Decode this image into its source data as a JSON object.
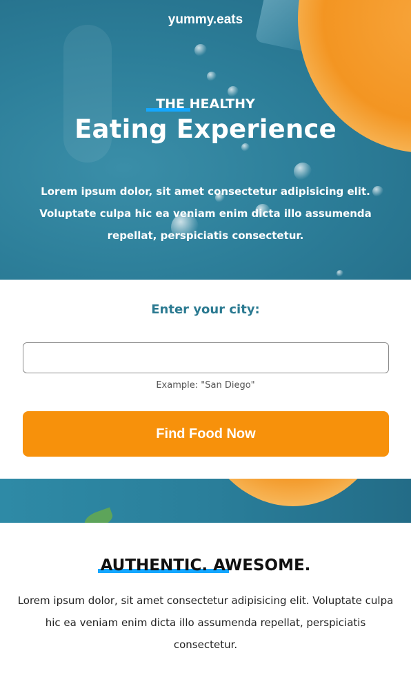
{
  "brand": {
    "name": "yummy.eats"
  },
  "hero": {
    "eyebrow": "THE HEALTHY",
    "title": "Eating Experience",
    "text": "Lorem ipsum dolor, sit amet consectetur adipisicing elit. Voluptate culpa hic ea veniam enim dicta illo assumenda repellat, perspiciatis consectetur."
  },
  "form": {
    "label": "Enter your city:",
    "input_value": "",
    "example": "Example: \"San Diego\"",
    "button_label": "Find Food Now"
  },
  "about": {
    "title": "AUTHENTIC. AWESOME.",
    "text": "Lorem ipsum dolor, sit amet consectetur adipisicing elit. Voluptate culpa hic ea veniam enim dicta illo assumenda repellat, perspiciatis consectetur."
  },
  "colors": {
    "accent": "#f7910b",
    "underline": "#14a7ff",
    "teal": "#2b7a91"
  }
}
